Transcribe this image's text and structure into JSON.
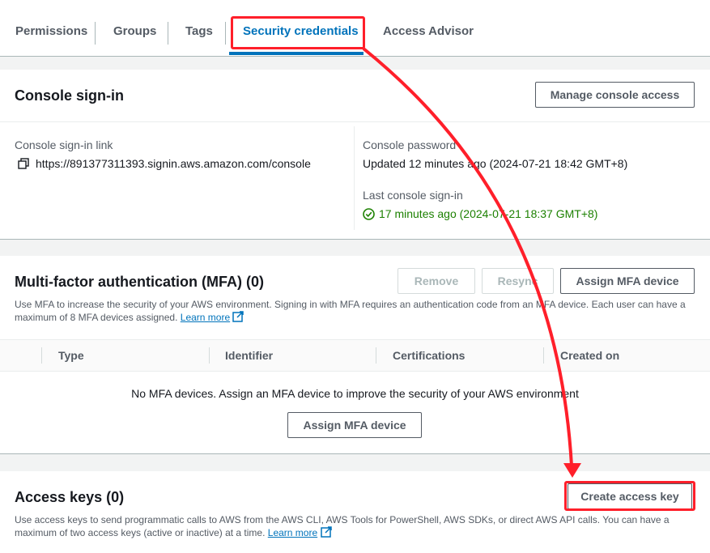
{
  "tabs": [
    {
      "label": "Permissions"
    },
    {
      "label": "Groups"
    },
    {
      "label": "Tags"
    },
    {
      "label": "Security credentials"
    },
    {
      "label": "Access Advisor"
    }
  ],
  "console_signin": {
    "title": "Console sign-in",
    "manage_button": "Manage console access",
    "link_label": "Console sign-in link",
    "link_value": "https://891377311393.signin.aws.amazon.com/console",
    "password_label": "Console password",
    "password_value": "Updated 12 minutes ago (2024-07-21 18:42 GMT+8)",
    "last_signin_label": "Last console sign-in",
    "last_signin_value": "17 minutes ago (2024-07-21 18:37 GMT+8)"
  },
  "mfa": {
    "title": "Multi-factor authentication (MFA) (0)",
    "remove_button": "Remove",
    "resync_button": "Resync",
    "assign_button": "Assign MFA device",
    "description_line1": "Use MFA to increase the security of your AWS environment. Signing in with MFA requires an authentication code from an MFA device. Each user can have a",
    "description_line2": "maximum of 8 MFA devices assigned.",
    "learn_more": "Learn more",
    "columns": [
      "Type",
      "Identifier",
      "Certifications",
      "Created on"
    ],
    "empty_text": "No MFA devices. Assign an MFA device to improve the security of your AWS environment",
    "empty_assign_button": "Assign MFA device"
  },
  "access_keys": {
    "title": "Access keys (0)",
    "create_button": "Create access key",
    "description_line1": "Use access keys to send programmatic calls to AWS from the AWS CLI, AWS Tools for PowerShell, AWS SDKs, or direct AWS API calls. You can have a",
    "description_line2": "maximum of two access keys (active or inactive) at a time.",
    "learn_more": "Learn more"
  },
  "icons": {
    "copy": "copy-icon",
    "check": "check-circle-icon",
    "external": "external-link-icon"
  },
  "colors": {
    "accent": "#0073bb",
    "annotation": "#ff1f2a",
    "success": "#1d8102"
  }
}
